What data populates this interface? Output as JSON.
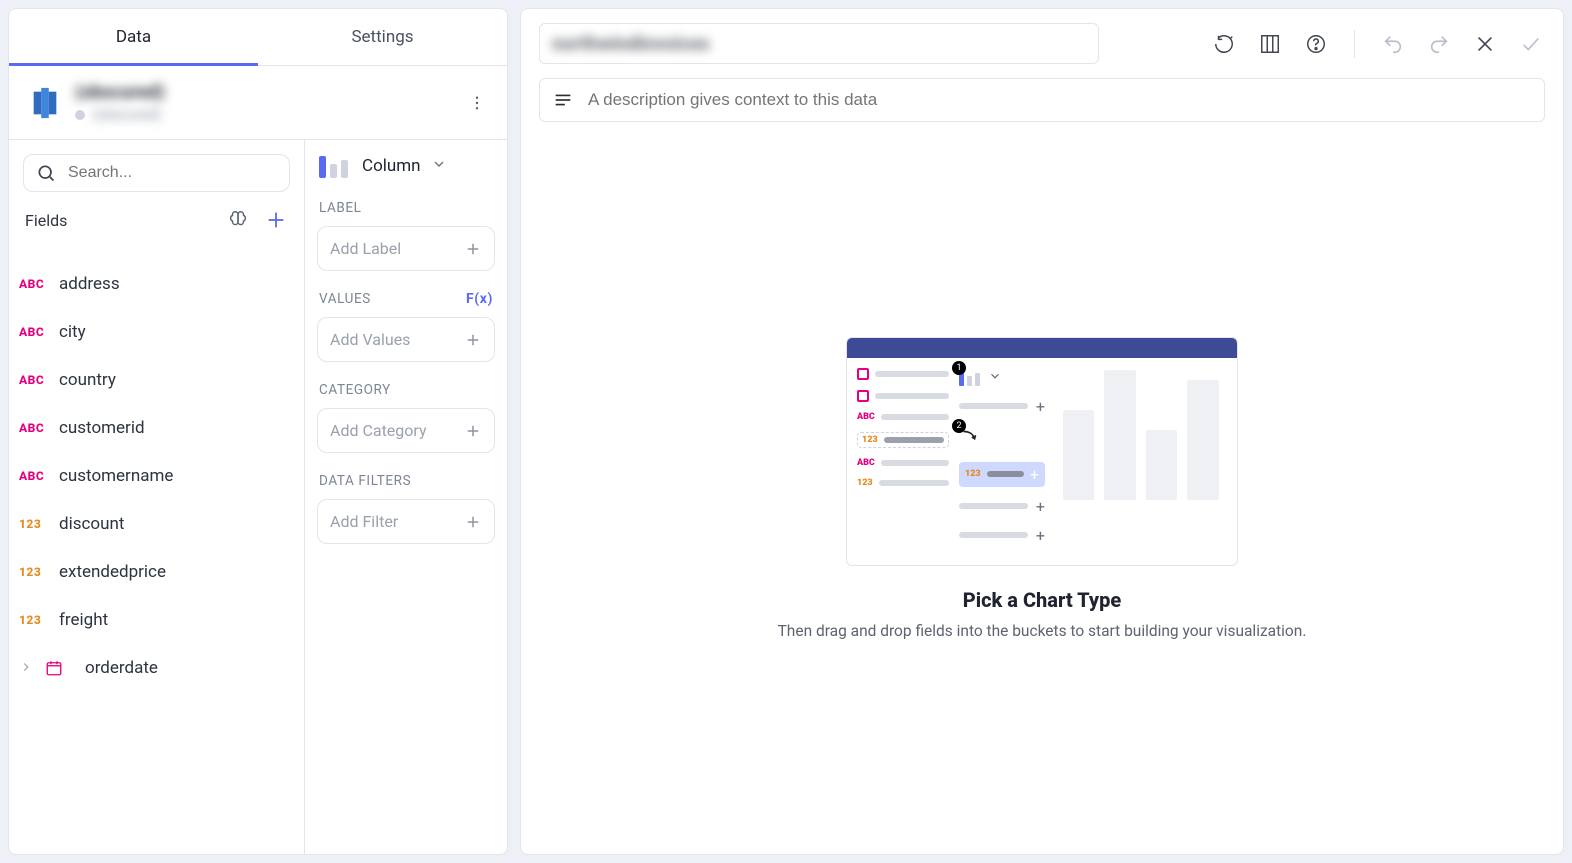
{
  "tabs": {
    "data": "Data",
    "settings": "Settings"
  },
  "datasource": {
    "name": "(obscured)",
    "subtitle": "(obscured)"
  },
  "search": {
    "placeholder": "Search..."
  },
  "fieldsHeader": "Fields",
  "fields": [
    {
      "type": "abc",
      "name": "address"
    },
    {
      "type": "abc",
      "name": "city"
    },
    {
      "type": "abc",
      "name": "country"
    },
    {
      "type": "abc",
      "name": "customerid"
    },
    {
      "type": "abc",
      "name": "customername"
    },
    {
      "type": "num",
      "name": "discount"
    },
    {
      "type": "num",
      "name": "extendedprice"
    },
    {
      "type": "num",
      "name": "freight"
    },
    {
      "type": "date",
      "name": "orderdate",
      "chevron": true
    }
  ],
  "chartType": {
    "label": "Column"
  },
  "shelves": {
    "label": {
      "title": "LABEL",
      "placeholder": "Add Label"
    },
    "values": {
      "title": "VALUES",
      "placeholder": "Add Values",
      "fx": "F(x)"
    },
    "category": {
      "title": "CATEGORY",
      "placeholder": "Add Category"
    },
    "filters": {
      "title": "DATA FILTERS",
      "placeholder": "Add Filter"
    }
  },
  "title": {
    "text": "northwindinvoices"
  },
  "description": {
    "placeholder": "A description gives context to this data"
  },
  "placeholder": {
    "title": "Pick a Chart Type",
    "subtitle": "Then drag and drop fields into the buckets to start building your visualization."
  }
}
